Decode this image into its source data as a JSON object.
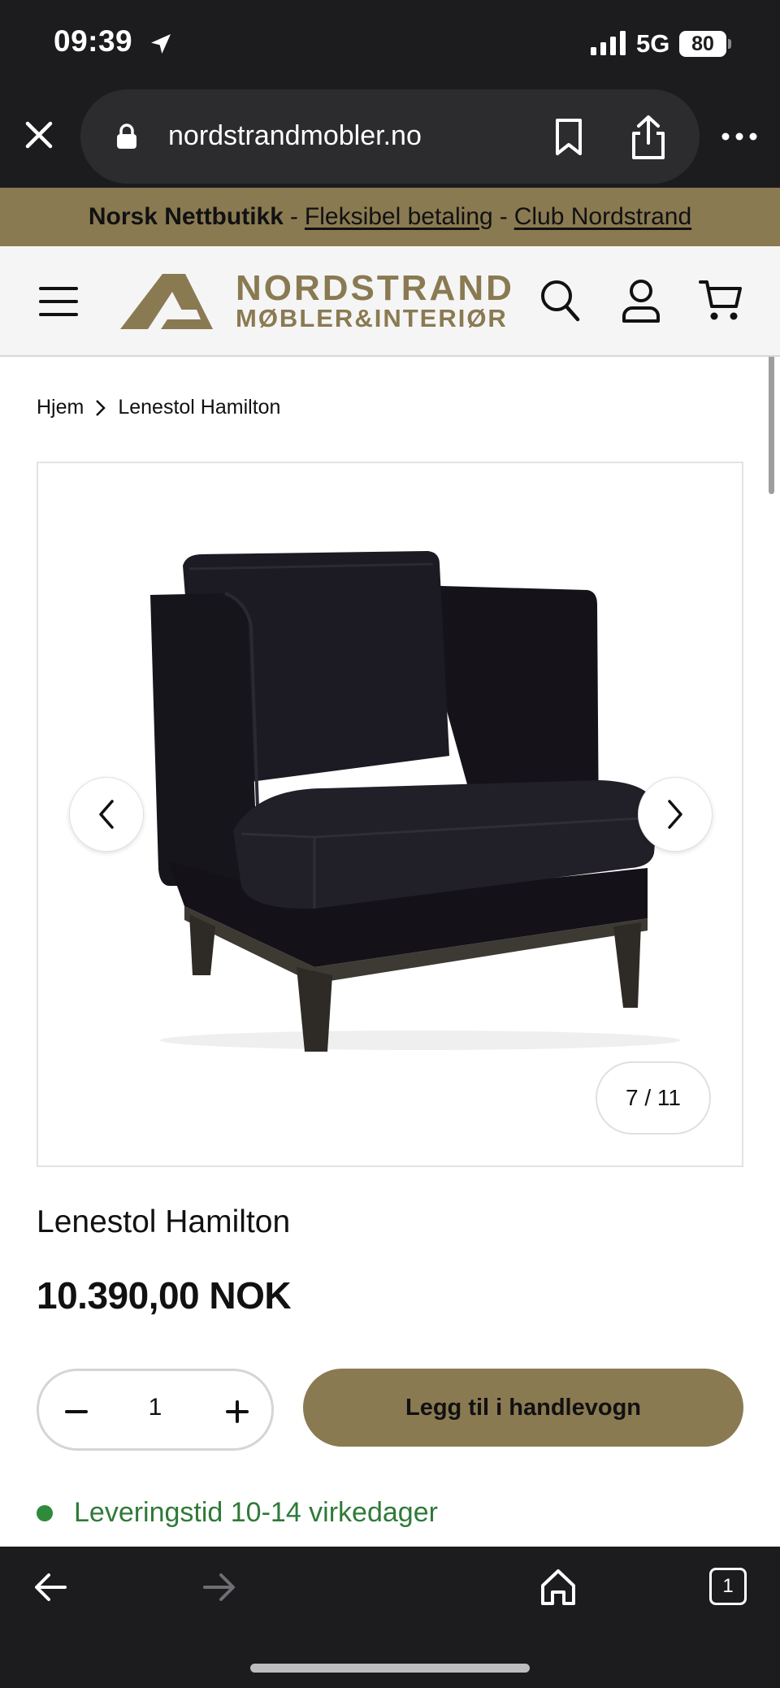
{
  "status_bar": {
    "time": "09:39",
    "network": "5G",
    "battery": "80"
  },
  "browser": {
    "url": "nordstrandmobler.no",
    "open_tabs": "1"
  },
  "promo": {
    "bold": "Norsk Nettbutikk",
    "separator": "-",
    "link1": "Fleksibel betaling",
    "link2": "Club Nordstrand"
  },
  "logo": {
    "line1": "NORDSTRAND",
    "line2": "MØBLER&INTERIØR"
  },
  "breadcrumb": {
    "home": "Hjem",
    "current": "Lenestol Hamilton"
  },
  "gallery": {
    "counter": "7 / 11"
  },
  "product": {
    "title": "Lenestol Hamilton",
    "price": "10.390,00 NOK",
    "quantity": "1",
    "add_to_cart": "Legg til i handlevogn",
    "delivery": "Leveringstid 10-14 virkedager"
  },
  "colors": {
    "brand": "#8a7a52",
    "chrome": "#1c1c1e",
    "delivery_green": "#2f8a3a"
  },
  "icons": [
    "location-arrow-icon",
    "signal-icon",
    "close-icon",
    "lock-icon",
    "bookmark-icon",
    "share-icon",
    "more-icon",
    "menu-icon",
    "search-icon",
    "account-icon",
    "cart-icon",
    "chevron-right-icon",
    "chevron-left-icon",
    "minus-icon",
    "plus-icon",
    "back-arrow-icon",
    "forward-arrow-icon",
    "home-icon",
    "tabs-icon"
  ]
}
